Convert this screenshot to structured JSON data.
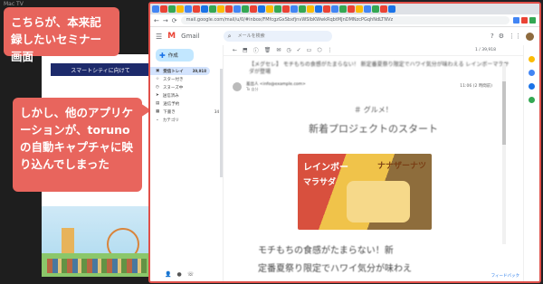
{
  "window": {
    "title": "Mac TV"
  },
  "slide": {
    "title": "スマートシティに向けて"
  },
  "annotations": {
    "top": "こちらが、本来記録したいセミナー画面",
    "middle": "しかし、他のアプリケーションが、torunoの自動キャプチャに映り込んでしまった"
  },
  "browser": {
    "url": "mail.google.com/mail/u/0/#inbox/FMfcgzGxSbxfjnvWSlbKWwkRqbtMJnDMNzcPGqhNdLTNVz",
    "tab_colors": [
      "#4285f4",
      "#ea4335",
      "#34a853",
      "#fbbc05",
      "#4285f4",
      "#ea4335",
      "#1a73e8",
      "#34a853",
      "#fbbc05",
      "#ea4335",
      "#4285f4",
      "#34a853",
      "#ea4335",
      "#1a73e8",
      "#fbbc05",
      "#34a853",
      "#ea4335",
      "#4285f4",
      "#34a853",
      "#fbbc05",
      "#1a73e8",
      "#ea4335",
      "#4285f4",
      "#34a853",
      "#ea4335",
      "#fbbc05",
      "#4285f4",
      "#34a853",
      "#ea4335",
      "#1a73e8"
    ]
  },
  "gmail": {
    "logo": "M",
    "name": "Gmail",
    "search_placeholder": "メールを検索",
    "compose_label": "作成",
    "sidebar": [
      {
        "icon": "inbox-icon",
        "label": "受信トレイ",
        "count": "39,918",
        "active": true
      },
      {
        "icon": "star-icon",
        "label": "スター付き",
        "count": ""
      },
      {
        "icon": "clock-icon",
        "label": "スヌーズ中",
        "count": ""
      },
      {
        "icon": "send-icon",
        "label": "送信済み",
        "count": ""
      },
      {
        "icon": "file-icon",
        "label": "送信予約",
        "count": ""
      },
      {
        "icon": "draft-icon",
        "label": "下書き",
        "count": "34"
      },
      {
        "icon": "chevron-down-icon",
        "label": "カテゴリ",
        "count": ""
      }
    ],
    "pager": "1 / 39,918",
    "subject": "【メグセレ】 モチもちの食感がたまらない！ 新定番夏祭り限定でハワイ気分が味わえる レインボーマラサダが登場",
    "sender_name": "差出人 <info@example.com>",
    "sender_to": "To 自分",
    "time": "11:06 (2 時間前)",
    "message": {
      "heading": "＃ グルメ！",
      "subheading": "新着プロジェクトのスタート",
      "promo_title1": "レインボー",
      "promo_title2": "マラサダ",
      "promo_title3": "ナナザーナツ",
      "paragraph1": "モチもちの食感がたまらない！新",
      "paragraph2": "定番夏祭り限定でハワイ気分が味わえ"
    },
    "feedback": "フィードバック"
  }
}
